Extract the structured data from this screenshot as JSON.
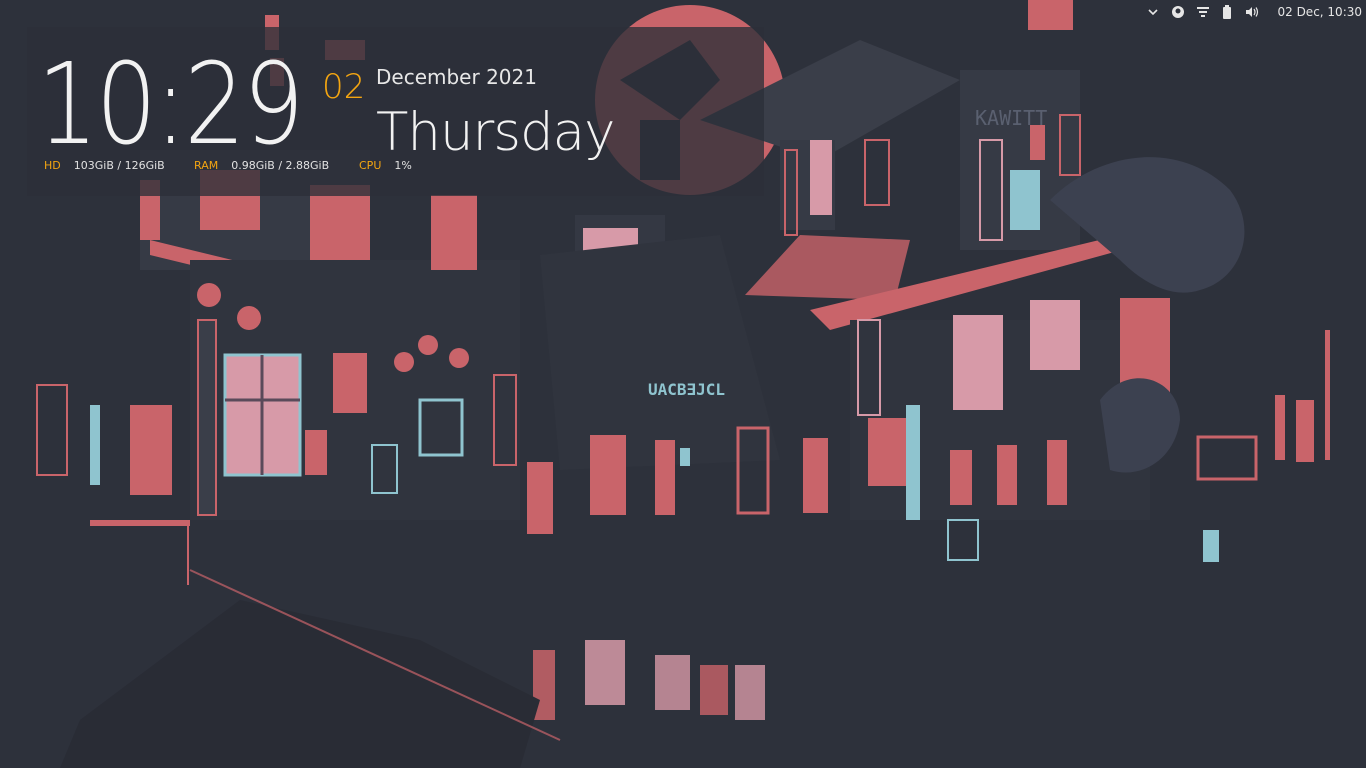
{
  "tray": {
    "icons": [
      "chevron-down-icon",
      "user-circle-icon",
      "network-icon",
      "battery-icon",
      "volume-icon"
    ],
    "clock": "02 Dec, 10:30"
  },
  "conky": {
    "time": "10:29",
    "day": "02",
    "month_year": "December 2021",
    "weekday": "Thursday",
    "stats": {
      "hd_label": "HD",
      "hd_value": "103GiB / 126GiB",
      "ram_label": "RAM",
      "ram_value": "0.98GiB / 2.88GiB",
      "cpu_label": "CPU",
      "cpu_value": "1%"
    },
    "accent_color": "#f3a511"
  },
  "wallpaper": {
    "description_colors": {
      "background": "#2d313b",
      "red": "#c9646a",
      "pink": "#d79aa8",
      "cyan": "#8fc4cf"
    }
  }
}
